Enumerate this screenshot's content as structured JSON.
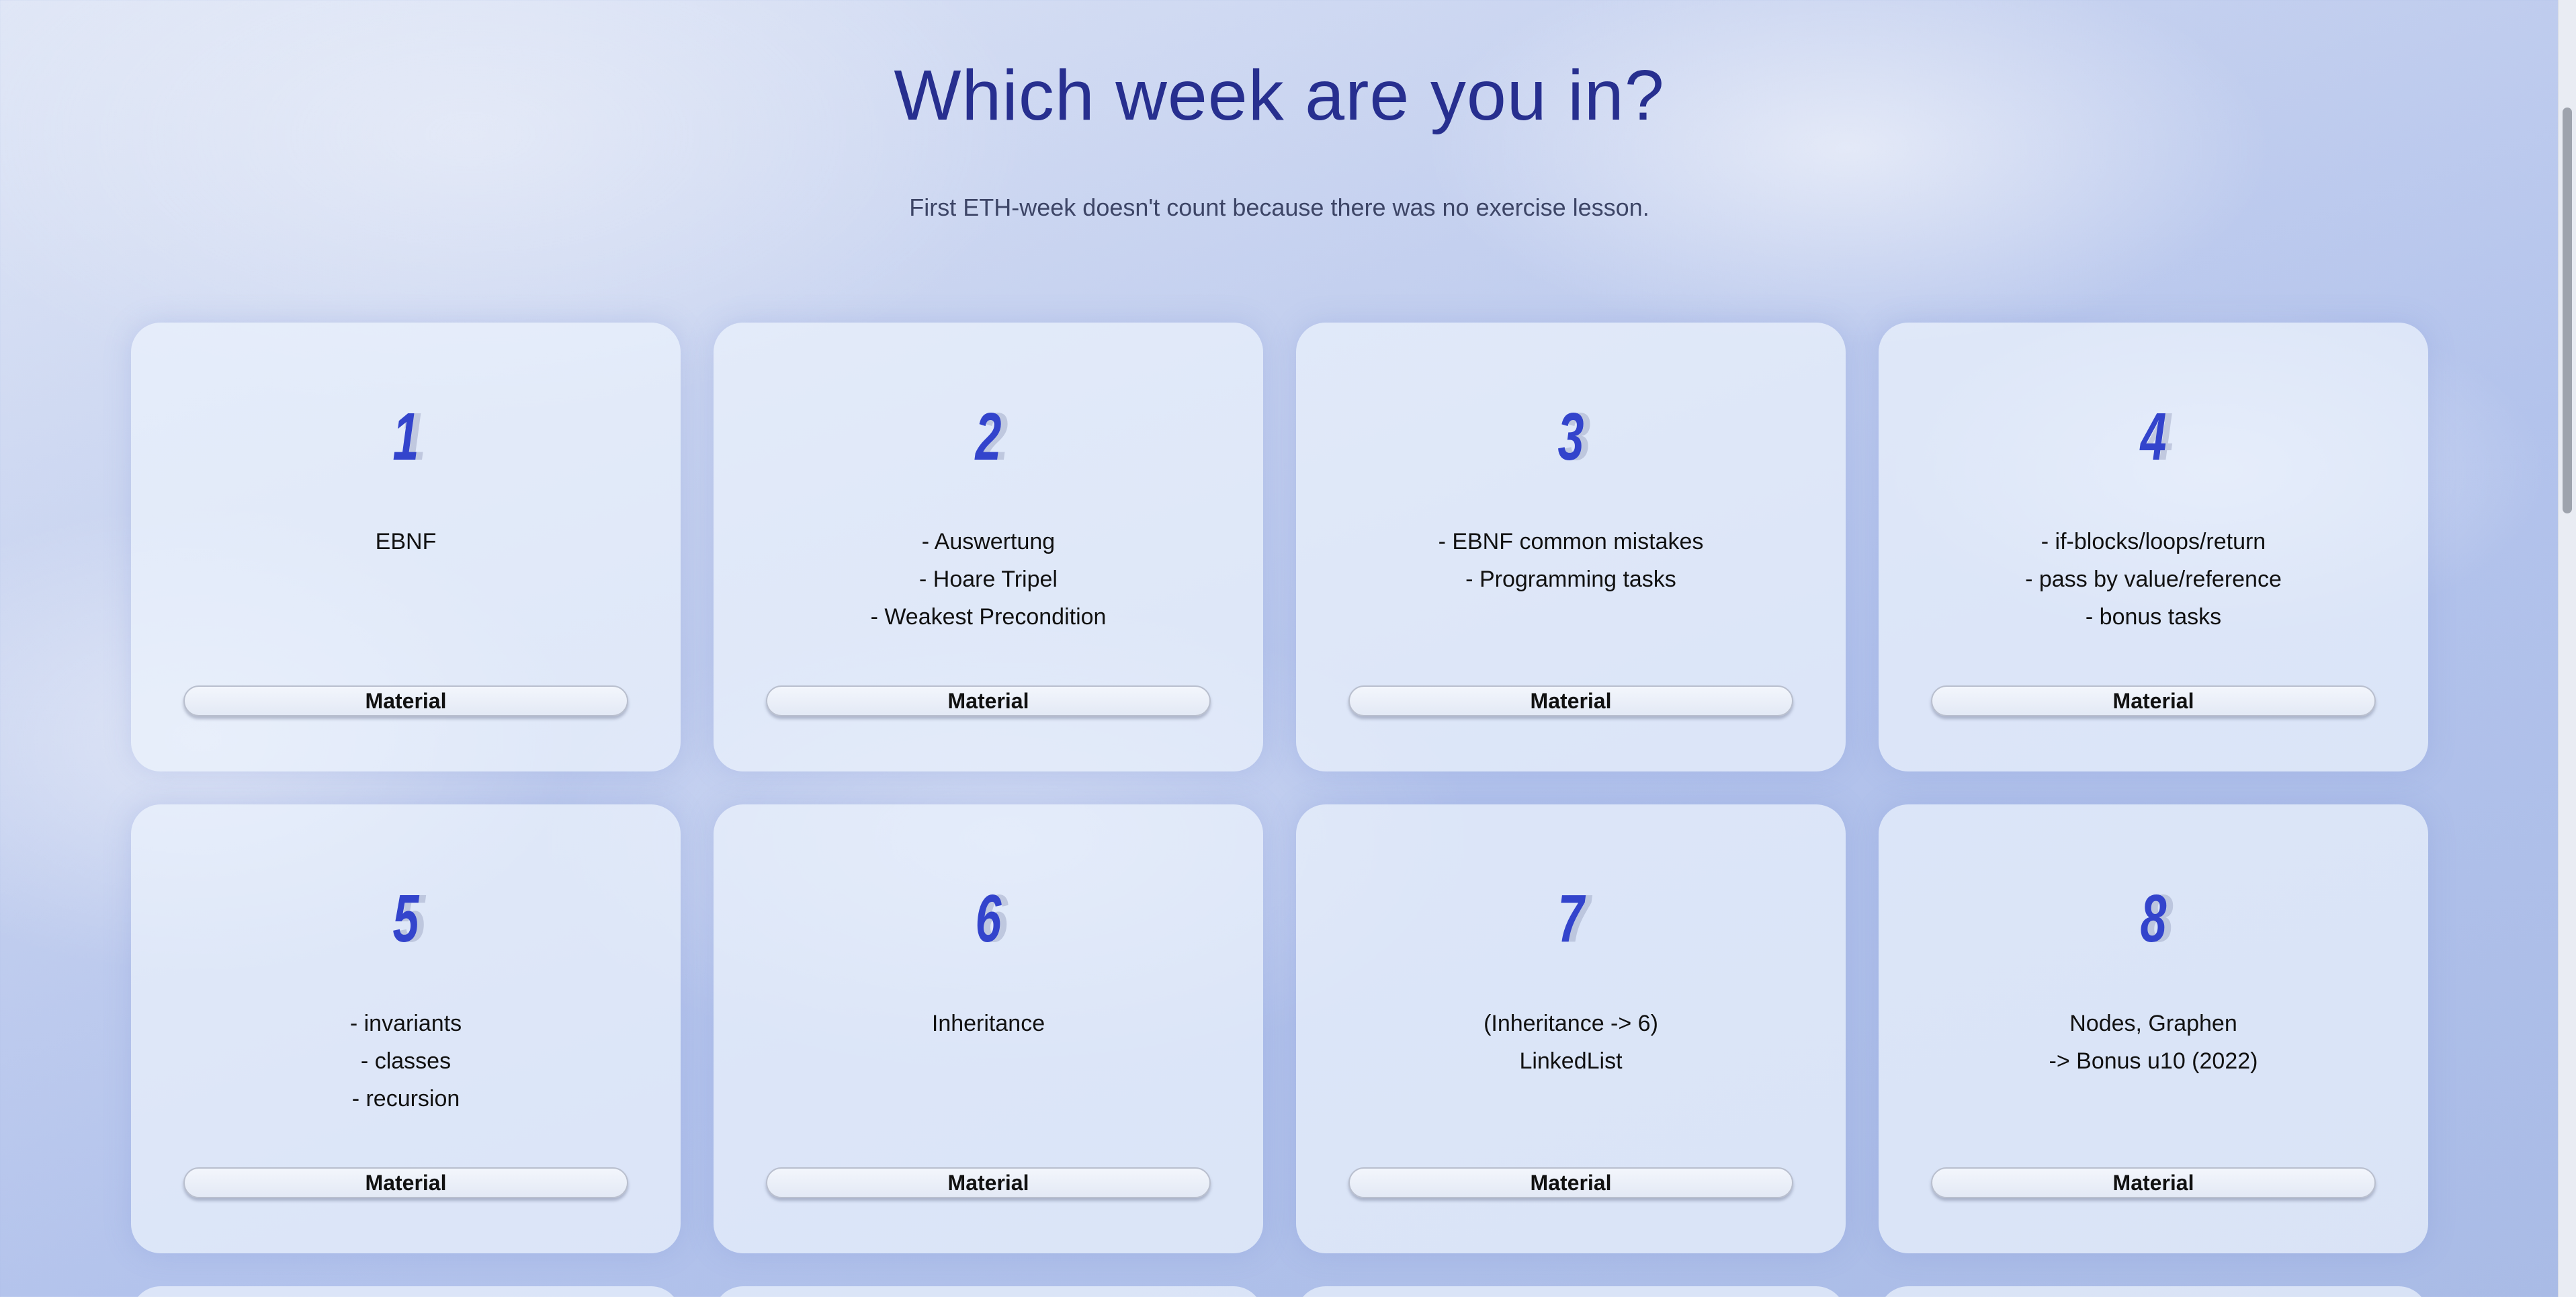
{
  "header": {
    "title": "Which week are you in?",
    "subtitle": "First ETH-week doesn't count because there was no exercise lesson."
  },
  "weeks": [
    {
      "number": "1",
      "description": "EBNF",
      "button_label": "Material"
    },
    {
      "number": "2",
      "description": "- Auswertung\n- Hoare Tripel\n- Weakest Precondition",
      "button_label": "Material"
    },
    {
      "number": "3",
      "description": "- EBNF common mistakes\n- Programming tasks",
      "button_label": "Material"
    },
    {
      "number": "4",
      "description": "- if-blocks/loops/return\n- pass by value/reference\n- bonus tasks",
      "button_label": "Material"
    },
    {
      "number": "5",
      "description": "- invariants\n- classes\n- recursion",
      "button_label": "Material"
    },
    {
      "number": "6",
      "description": "Inheritance",
      "button_label": "Material"
    },
    {
      "number": "7",
      "description": "(Inheritance -> 6)\nLinkedList",
      "button_label": "Material"
    },
    {
      "number": "8",
      "description": "Nodes, Graphen\n-> Bonus u10 (2022)",
      "button_label": "Material"
    }
  ],
  "colors": {
    "title": "#272f8f",
    "number": "#3344cc",
    "card_background": "#ecf2fc"
  }
}
